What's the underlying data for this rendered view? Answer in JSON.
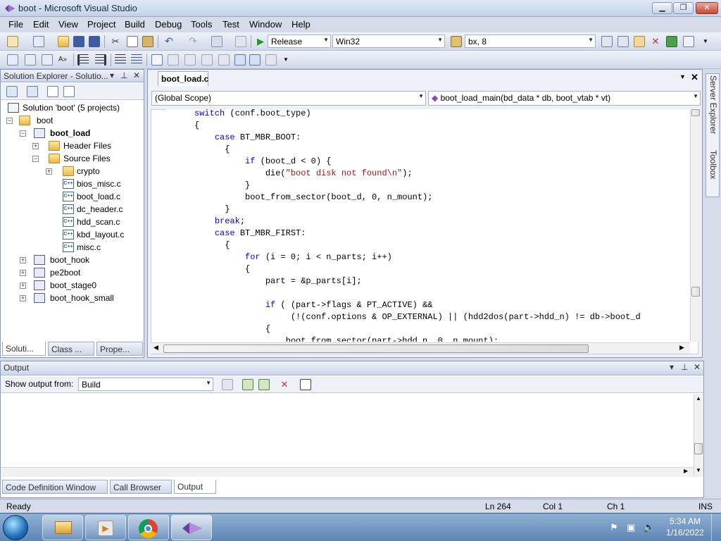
{
  "window": {
    "title": "boot - Microsoft Visual Studio",
    "min_label": "▁",
    "max_label": "❐",
    "close_label": "✕"
  },
  "menu": [
    "File",
    "Edit",
    "View",
    "Project",
    "Build",
    "Debug",
    "Tools",
    "Test",
    "Window",
    "Help"
  ],
  "toolbar": {
    "configuration": "Release",
    "platform": "Win32",
    "find_text": "bx, 8"
  },
  "solution_explorer": {
    "header": "Solution Explorer - Solutio...",
    "items": [
      {
        "label": "Solution 'boot' (5 projects)",
        "kind": "sln",
        "expander": ""
      },
      {
        "label": "boot",
        "kind": "folder",
        "expander": "−"
      },
      {
        "label": "boot_load",
        "kind": "proj",
        "expander": "−",
        "bold": true
      },
      {
        "label": "Header Files",
        "kind": "folder",
        "expander": "+"
      },
      {
        "label": "Source Files",
        "kind": "folder",
        "expander": "−"
      },
      {
        "label": "crypto",
        "kind": "folder",
        "expander": "+"
      },
      {
        "label": "bios_misc.c",
        "kind": "file",
        "expander": ""
      },
      {
        "label": "boot_load.c",
        "kind": "file",
        "expander": ""
      },
      {
        "label": "dc_header.c",
        "kind": "file",
        "expander": ""
      },
      {
        "label": "hdd_scan.c",
        "kind": "file",
        "expander": ""
      },
      {
        "label": "kbd_layout.c",
        "kind": "file",
        "expander": ""
      },
      {
        "label": "misc.c",
        "kind": "file",
        "expander": ""
      },
      {
        "label": "boot_hook",
        "kind": "proj",
        "expander": "+"
      },
      {
        "label": "pe2boot",
        "kind": "proj",
        "expander": "+"
      },
      {
        "label": "boot_stage0",
        "kind": "proj",
        "expander": "+"
      },
      {
        "label": "boot_hook_small",
        "kind": "proj",
        "expander": "+"
      }
    ],
    "file_badge": "C++",
    "tabs": [
      "Soluti...",
      "Class ...",
      "Prope..."
    ]
  },
  "editor": {
    "tab": "boot_load.c",
    "scope": "(Global Scope)",
    "function": "boot_load_main(bd_data * db, boot_vtab * vt)",
    "lines": [
      [
        {
          "t": "switch",
          "c": "kw"
        },
        {
          "t": " (conf.boot_type)"
        }
      ],
      [
        {
          "t": "{"
        }
      ],
      [
        {
          "t": "    "
        },
        {
          "t": "case",
          "c": "kw"
        },
        {
          "t": " BT_MBR_BOOT:"
        }
      ],
      [
        {
          "t": "      {"
        }
      ],
      [
        {
          "t": "          "
        },
        {
          "t": "if",
          "c": "kw"
        },
        {
          "t": " (boot_d < 0) {"
        }
      ],
      [
        {
          "t": "              die("
        },
        {
          "t": "\"boot disk not found\\n\"",
          "c": "str"
        },
        {
          "t": ");"
        }
      ],
      [
        {
          "t": "          }"
        }
      ],
      [
        {
          "t": "          boot_from_sector(boot_d, 0, n_mount);"
        }
      ],
      [
        {
          "t": "      }"
        }
      ],
      [
        {
          "t": "    "
        },
        {
          "t": "break",
          "c": "kw"
        },
        {
          "t": ";"
        }
      ],
      [
        {
          "t": "    "
        },
        {
          "t": "case",
          "c": "kw"
        },
        {
          "t": " BT_MBR_FIRST:"
        }
      ],
      [
        {
          "t": "      {"
        }
      ],
      [
        {
          "t": "          "
        },
        {
          "t": "for",
          "c": "kw"
        },
        {
          "t": " (i = 0; i < n_parts; i++)"
        }
      ],
      [
        {
          "t": "          {"
        }
      ],
      [
        {
          "t": "              part = &p_parts[i];"
        }
      ],
      [
        {
          "t": ""
        }
      ],
      [
        {
          "t": "              "
        },
        {
          "t": "if",
          "c": "kw"
        },
        {
          "t": " ( (part->flags & PT_ACTIVE) &&"
        }
      ],
      [
        {
          "t": "                   (!(conf.options & OP_EXTERNAL) || (hdd2dos(part->hdd_n) != db->boot_d"
        }
      ],
      [
        {
          "t": "              {"
        }
      ],
      [
        {
          "t": "                  boot_from_sector(part->hdd_n, 0, n_mount);"
        }
      ]
    ]
  },
  "side_tabs": [
    "Server Explorer",
    "Toolbox"
  ],
  "output": {
    "header": "Output",
    "show_from_label": "Show output from:",
    "show_from_value": "Build",
    "tabs": [
      "Code Definition Window",
      "Call Browser",
      "Output"
    ]
  },
  "status": {
    "text": "Ready",
    "ln": "Ln 264",
    "col": "Col 1",
    "ch": "Ch 1",
    "mode": "INS"
  },
  "clock": {
    "time": "5:34 AM",
    "date": "1/16/2022"
  },
  "colors": {
    "keyword": "#0000ff",
    "string": "#a31515"
  }
}
